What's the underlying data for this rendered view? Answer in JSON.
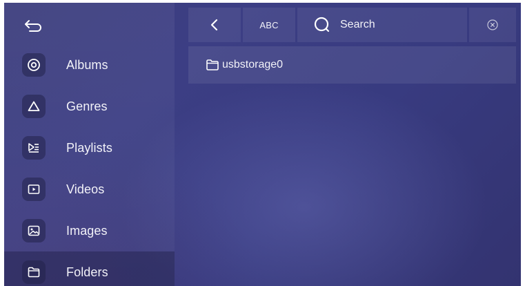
{
  "sidebar": {
    "back_icon": "back-arrow-icon",
    "items": [
      {
        "label": "Albums",
        "icon": "album-icon"
      },
      {
        "label": "Genres",
        "icon": "triangle-icon"
      },
      {
        "label": "Playlists",
        "icon": "playlist-icon"
      },
      {
        "label": "Videos",
        "icon": "video-icon"
      },
      {
        "label": "Images",
        "icon": "image-icon"
      },
      {
        "label": "Folders",
        "icon": "folder-icon",
        "active": true
      }
    ]
  },
  "toolbar": {
    "prev_icon": "chevron-left-icon",
    "abc_label": "ABC",
    "search_icon": "search-icon",
    "search_label": "Search",
    "clear_icon": "clear-circle-icon"
  },
  "folders": [
    {
      "name": "usbstorage0",
      "icon": "folder-icon"
    }
  ],
  "colors": {
    "background": "#3b3c7c",
    "text": "#f2f2f8"
  }
}
